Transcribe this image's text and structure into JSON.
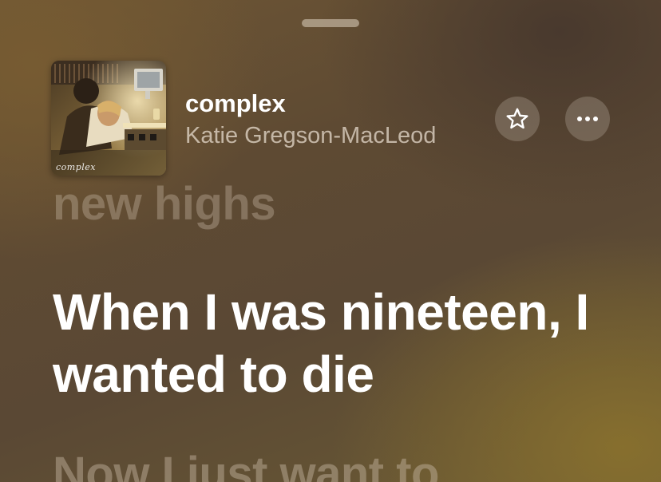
{
  "player": {
    "track": {
      "title": "complex",
      "artist": "Katie Gregson-MacLeod",
      "artwork_caption": "complex"
    },
    "actions": {
      "favorite_icon": "star-icon",
      "more_icon": "ellipsis-icon"
    }
  },
  "lyrics": {
    "previous": "new highs",
    "current": "When I was nineteen, I wanted to die",
    "next": "Now I just want to"
  }
}
